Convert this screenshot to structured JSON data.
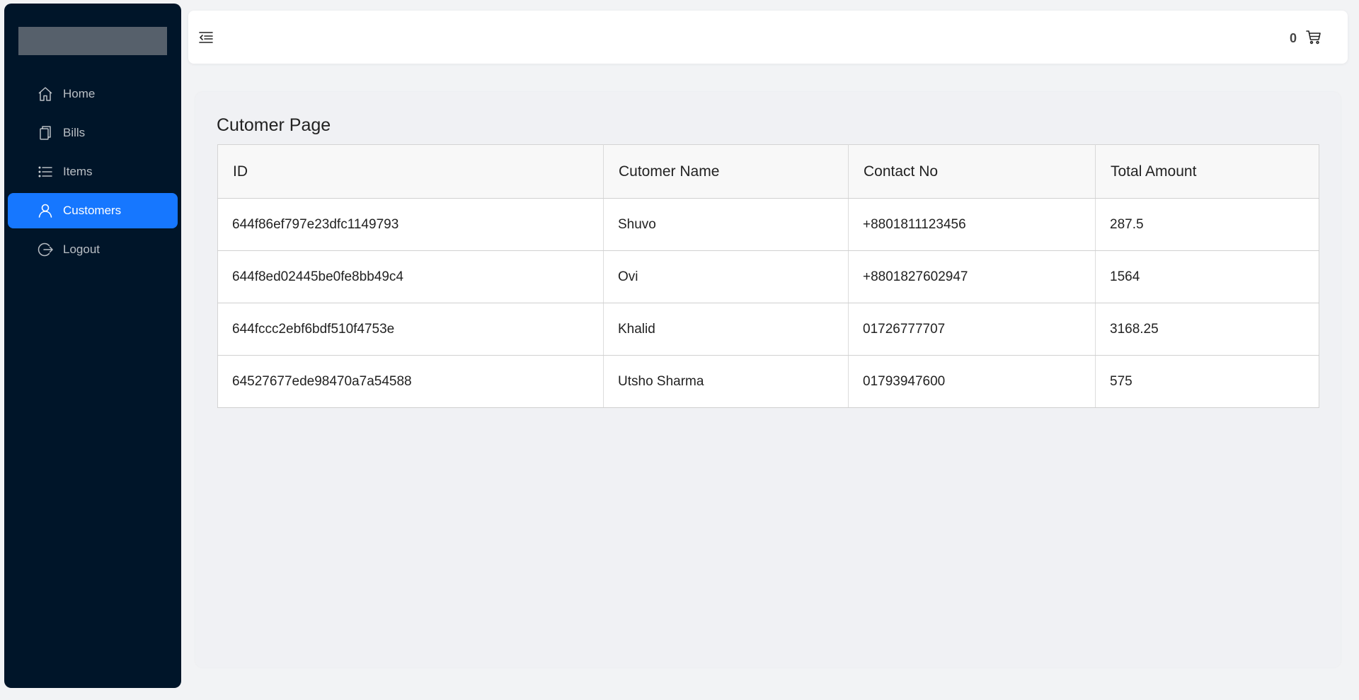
{
  "sidebar": {
    "items": [
      {
        "label": "Home",
        "icon": "home-icon",
        "active": false
      },
      {
        "label": "Bills",
        "icon": "copy-icon",
        "active": false
      },
      {
        "label": "Items",
        "icon": "list-icon",
        "active": false
      },
      {
        "label": "Customers",
        "icon": "user-icon",
        "active": true
      },
      {
        "label": "Logout",
        "icon": "logout-icon",
        "active": false
      }
    ]
  },
  "header": {
    "cart_count": "0"
  },
  "main": {
    "title": "Cutomer Page",
    "table": {
      "columns": [
        "ID",
        "Cutomer Name",
        "Contact No",
        "Total Amount"
      ],
      "rows": [
        [
          "644f86ef797e23dfc1149793",
          "Shuvo",
          "+8801811123456",
          "287.5"
        ],
        [
          "644f8ed02445be0fe8bb49c4",
          "Ovi",
          "+8801827602947",
          "1564"
        ],
        [
          "644fccc2ebf6bdf510f4753e",
          "Khalid",
          "01726777707",
          "3168.25"
        ],
        [
          "64527677ede98470a7a54588",
          "Utsho Sharma",
          "01793947600",
          "575"
        ]
      ]
    }
  },
  "colors": {
    "sidebar_bg": "#001529",
    "accent": "#1677ff"
  }
}
